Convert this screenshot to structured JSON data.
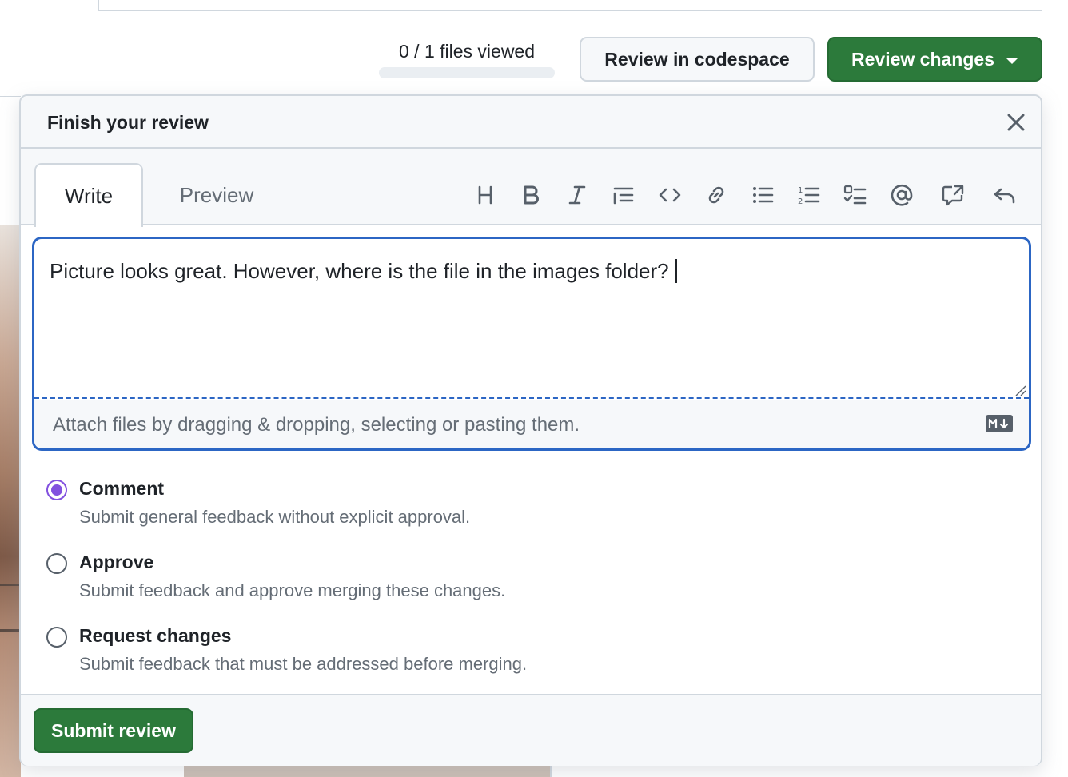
{
  "colors": {
    "primary_green": "#2c7a3b",
    "focus_blue": "#2c66c4",
    "radio_purple": "#8250df",
    "muted_text": "#656d76",
    "border": "#d0d7de"
  },
  "header_bar": {
    "files_viewed": "0 / 1 files viewed",
    "files_viewed_progress": 0,
    "review_in_codespace": "Review in codespace",
    "review_changes": "Review changes"
  },
  "modal": {
    "title": "Finish your review",
    "tabs": [
      {
        "label": "Write",
        "active": true
      },
      {
        "label": "Preview",
        "active": false
      }
    ],
    "toolbar_icons": [
      "heading-icon",
      "bold-icon",
      "italic-icon",
      "quote-icon",
      "code-icon",
      "link-icon",
      "bulleted-list-icon",
      "numbered-list-icon",
      "task-list-icon",
      "mention-icon",
      "cross-reference-icon",
      "undo-icon"
    ],
    "comment_text": "Picture looks great. However, where is the file in the images folder?",
    "attach_hint": "Attach files by dragging & dropping, selecting or pasting them.",
    "options": [
      {
        "label": "Comment",
        "description": "Submit general feedback without explicit approval.",
        "checked": true
      },
      {
        "label": "Approve",
        "description": "Submit feedback and approve merging these changes.",
        "checked": false
      },
      {
        "label": "Request changes",
        "description": "Submit feedback that must be addressed before merging.",
        "checked": false
      }
    ],
    "submit_label": "Submit review"
  }
}
